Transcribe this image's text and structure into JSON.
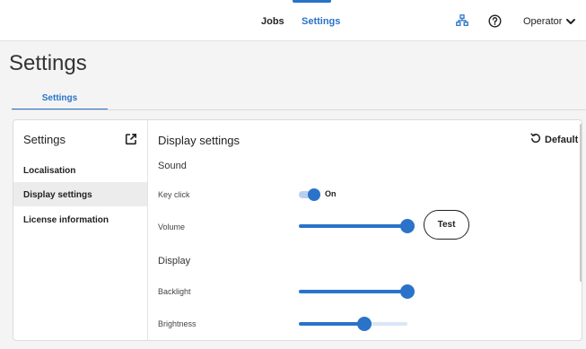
{
  "topbar": {
    "nav": {
      "jobs": "Jobs",
      "settings": "Settings"
    },
    "operator": "Operator",
    "icons": {
      "network": "network-icon",
      "help": "help-icon",
      "chevron": "chevron-down-icon"
    }
  },
  "page": {
    "title": "Settings",
    "tab": "Settings"
  },
  "sidebar": {
    "title": "Settings",
    "items": [
      {
        "label": "Localisation"
      },
      {
        "label": "Display settings"
      },
      {
        "label": "License information"
      }
    ]
  },
  "main": {
    "title": "Display settings",
    "default_label": "Default",
    "sound": {
      "title": "Sound",
      "key_click": {
        "label": "Key click",
        "state": "On"
      },
      "volume": {
        "label": "Volume",
        "level": 1.0
      },
      "test_label": "Test"
    },
    "display": {
      "title": "Display",
      "backlight": {
        "label": "Backlight",
        "level": 1.0
      },
      "brightness": {
        "label": "Brightness",
        "level": 0.6
      }
    }
  },
  "colors": {
    "accent": "#2a73c9",
    "background": "#f4f4f4",
    "toggle_track": "#b9cff0",
    "slider_track": "#dbe6f7"
  }
}
